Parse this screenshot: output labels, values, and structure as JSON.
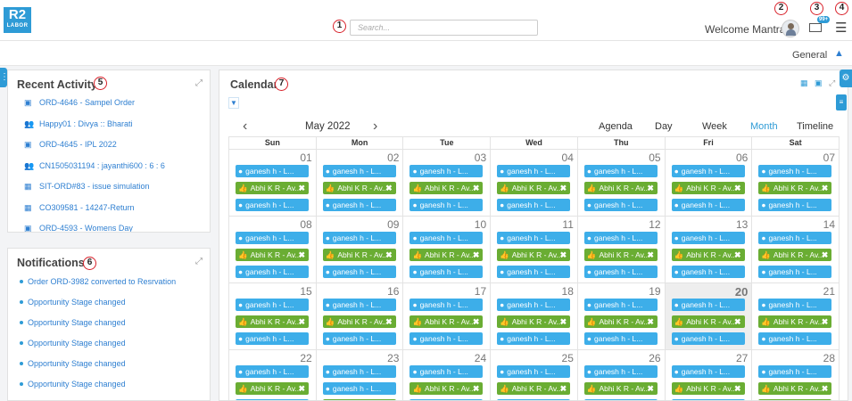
{
  "app": {
    "logo_text": "R2",
    "logo_sub": "LABOR"
  },
  "header": {
    "search_placeholder": "Search...",
    "welcome": "Welcome Mantra",
    "mail_badge": "99+",
    "markers": [
      "1",
      "2",
      "3",
      "4",
      "5",
      "6",
      "7"
    ]
  },
  "subbar": {
    "general_label": "General"
  },
  "recent_activity": {
    "title": "Recent Activity",
    "items": [
      {
        "icon": "briefcase-icon",
        "text": "ORD-4646 - Sampel Order"
      },
      {
        "icon": "users-icon",
        "text": "Happy01 : Divya :: Bharati"
      },
      {
        "icon": "briefcase-icon",
        "text": "ORD-4645 - IPL 2022"
      },
      {
        "icon": "users-icon",
        "text": "CN1505031194 : jayanthi600 : 6 : 6"
      },
      {
        "icon": "calendar-grid-icon",
        "text": "SIT-ORD#83 - issue simulation"
      },
      {
        "icon": "calendar-grid-icon",
        "text": "CO309581 - 14247-Return"
      },
      {
        "icon": "briefcase-icon",
        "text": "ORD-4593 - Womens Day"
      }
    ]
  },
  "notifications": {
    "title": "Notifications",
    "items": [
      "Order ORD-3982 converted to Resrvation",
      "Opportunity Stage changed",
      "Opportunity Stage changed",
      "Opportunity Stage changed",
      "Opportunity Stage changed",
      "Opportunity Stage changed"
    ]
  },
  "calendar": {
    "title": "Calendar",
    "month_label": "May 2022",
    "views": [
      "Agenda",
      "Day",
      "Week",
      "Month",
      "Timeline"
    ],
    "active_view": "Month",
    "weekdays": [
      "Sun",
      "Mon",
      "Tue",
      "Wed",
      "Thu",
      "Fri",
      "Sat"
    ],
    "weeks": [
      [
        "01",
        "02",
        "03",
        "04",
        "05",
        "06",
        "07"
      ],
      [
        "08",
        "09",
        "10",
        "11",
        "12",
        "13",
        "14"
      ],
      [
        "15",
        "16",
        "17",
        "18",
        "19",
        "20",
        "21"
      ],
      [
        "22",
        "23",
        "24",
        "25",
        "26",
        "27",
        "28"
      ]
    ],
    "today": "20",
    "event_blue_label": "ganesh h - L...",
    "event_green_label": "Abhi K R - Av...",
    "week_patterns": [
      [
        "bgb",
        "bgb",
        "bgb",
        "bgb",
        "bgb",
        "bgb",
        "bgb"
      ],
      [
        "bgb",
        "bgb",
        "bgb",
        "bgb",
        "bgb",
        "bgb",
        "bgb"
      ],
      [
        "bgb",
        "bgb",
        "bgb",
        "bgb",
        "bgb",
        "bgb",
        "bgb"
      ],
      [
        "bgb",
        "bbg",
        "bgb",
        "bgb",
        "bgb",
        "bgb",
        "bgg"
      ]
    ],
    "colors": {
      "blue": "#3daee9",
      "green": "#6aad33"
    }
  }
}
